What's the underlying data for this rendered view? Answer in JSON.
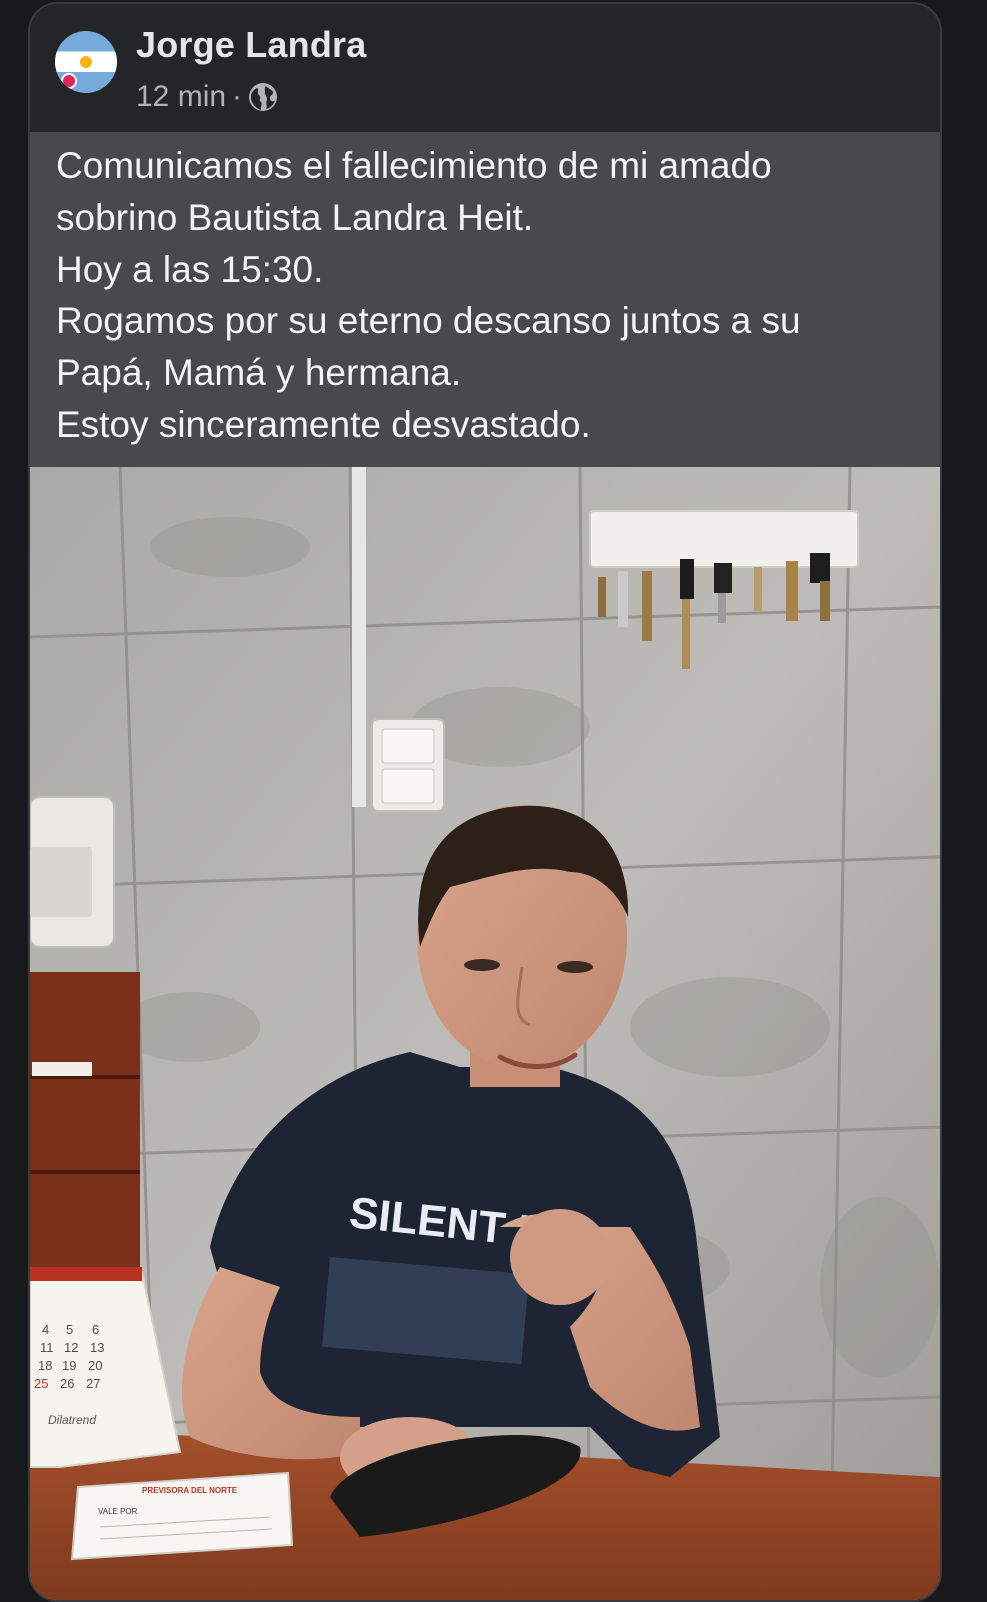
{
  "post": {
    "author": "Jorge Landra",
    "time": "12 min",
    "separator": "·",
    "privacy_icon": "globe-icon",
    "lines": [
      "Comunicamos el fallecimiento de mi amado",
      "sobrino Bautista Landra Heit.",
      "Hoy a las 15:30.",
      "Rogamos por su eterno descanso juntos a su",
      "Papá, Mamá y hermana.",
      "Estoy sinceramente desvastado."
    ]
  },
  "photo": {
    "shirt_text": "SILENT N",
    "calendar": {
      "row1": [
        "4",
        "5",
        "6"
      ],
      "row2": [
        "11",
        "12",
        "13"
      ],
      "row3": [
        "18",
        "19",
        "20"
      ],
      "row4": [
        "25",
        "26",
        "27"
      ],
      "brand": "Dilatrend"
    },
    "note_header": "PREVISORA DEL NORTE",
    "note_label": "VALE POR"
  },
  "colors": {
    "background": "#18191a",
    "card": "#242526",
    "text_band": "#48494a",
    "text": "#f2f3f5",
    "secondary_text": "#b0b3b8"
  }
}
